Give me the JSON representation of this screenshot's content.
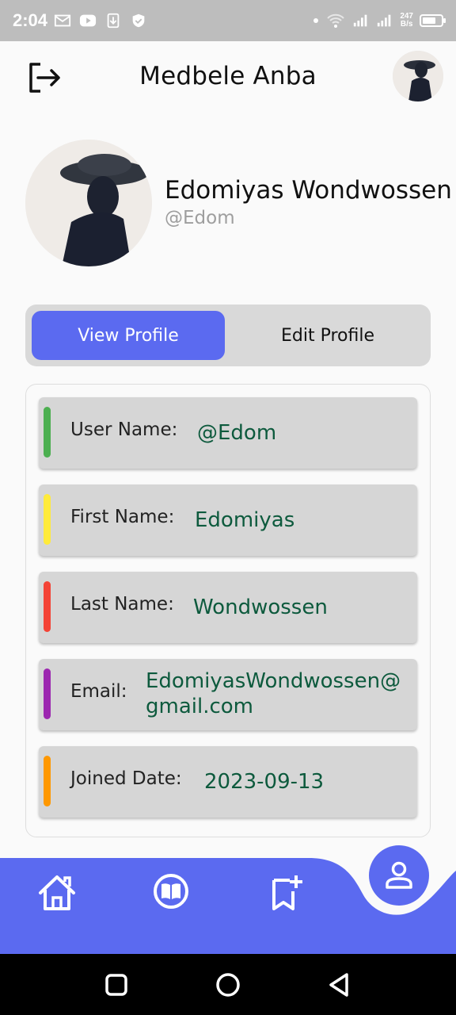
{
  "status_bar": {
    "time": "2:04",
    "speed_top": "247",
    "speed_bottom": "B/s",
    "icons": [
      "gmail-icon",
      "youtube-icon",
      "download-icon",
      "shield-icon",
      "dot-icon",
      "wifi-icon",
      "signal-icon",
      "signal-icon",
      "battery-icon"
    ]
  },
  "app_bar": {
    "title": "Medbele Anba",
    "left_icon": "logout-icon",
    "right_icon": "avatar"
  },
  "profile": {
    "name": "Edomiyas Wondwossen",
    "handle": "@Edom"
  },
  "tabs": [
    {
      "label": "View Profile",
      "active": true
    },
    {
      "label": "Edit Profile",
      "active": false
    }
  ],
  "details": [
    {
      "label": "User Name:",
      "value": "@Edom",
      "accent": "#4caf50"
    },
    {
      "label": "First Name:",
      "value": "Edomiyas",
      "accent": "#ffeb3b"
    },
    {
      "label": "Last Name:",
      "value": "Wondwossen",
      "accent": "#f44336"
    },
    {
      "label": "Email:",
      "value_line1": "EdomiyasWondwossen@",
      "value_line2": "gmail.com",
      "accent": "#9c27b0"
    },
    {
      "label": "Joined Date:",
      "value": "2023-09-13",
      "accent": "#ff9800"
    }
  ],
  "bottom_nav": {
    "items": [
      "home-icon",
      "book-icon",
      "bookmark-add-icon",
      "person-icon"
    ],
    "active": "person-icon",
    "color": "#5b6af0"
  },
  "system_nav": [
    "square-icon",
    "circle-icon",
    "back-triangle-icon"
  ]
}
